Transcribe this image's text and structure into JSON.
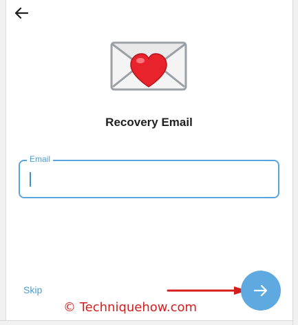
{
  "header": {
    "back_icon": "arrow-left-icon"
  },
  "hero": {
    "icon": "love-letter-envelope-icon"
  },
  "title": "Recovery Email",
  "email": {
    "label": "Email",
    "value": "",
    "placeholder": ""
  },
  "footer": {
    "skip_label": "Skip",
    "next_icon": "arrow-right-icon"
  },
  "annotation": {
    "arrow_icon": "red-pointer-arrow-icon",
    "watermark": "© Techniquehow.com"
  },
  "colors": {
    "accent": "#5ea9e0",
    "field_border": "#5aa3d8",
    "annotation": "#d41d1d"
  }
}
